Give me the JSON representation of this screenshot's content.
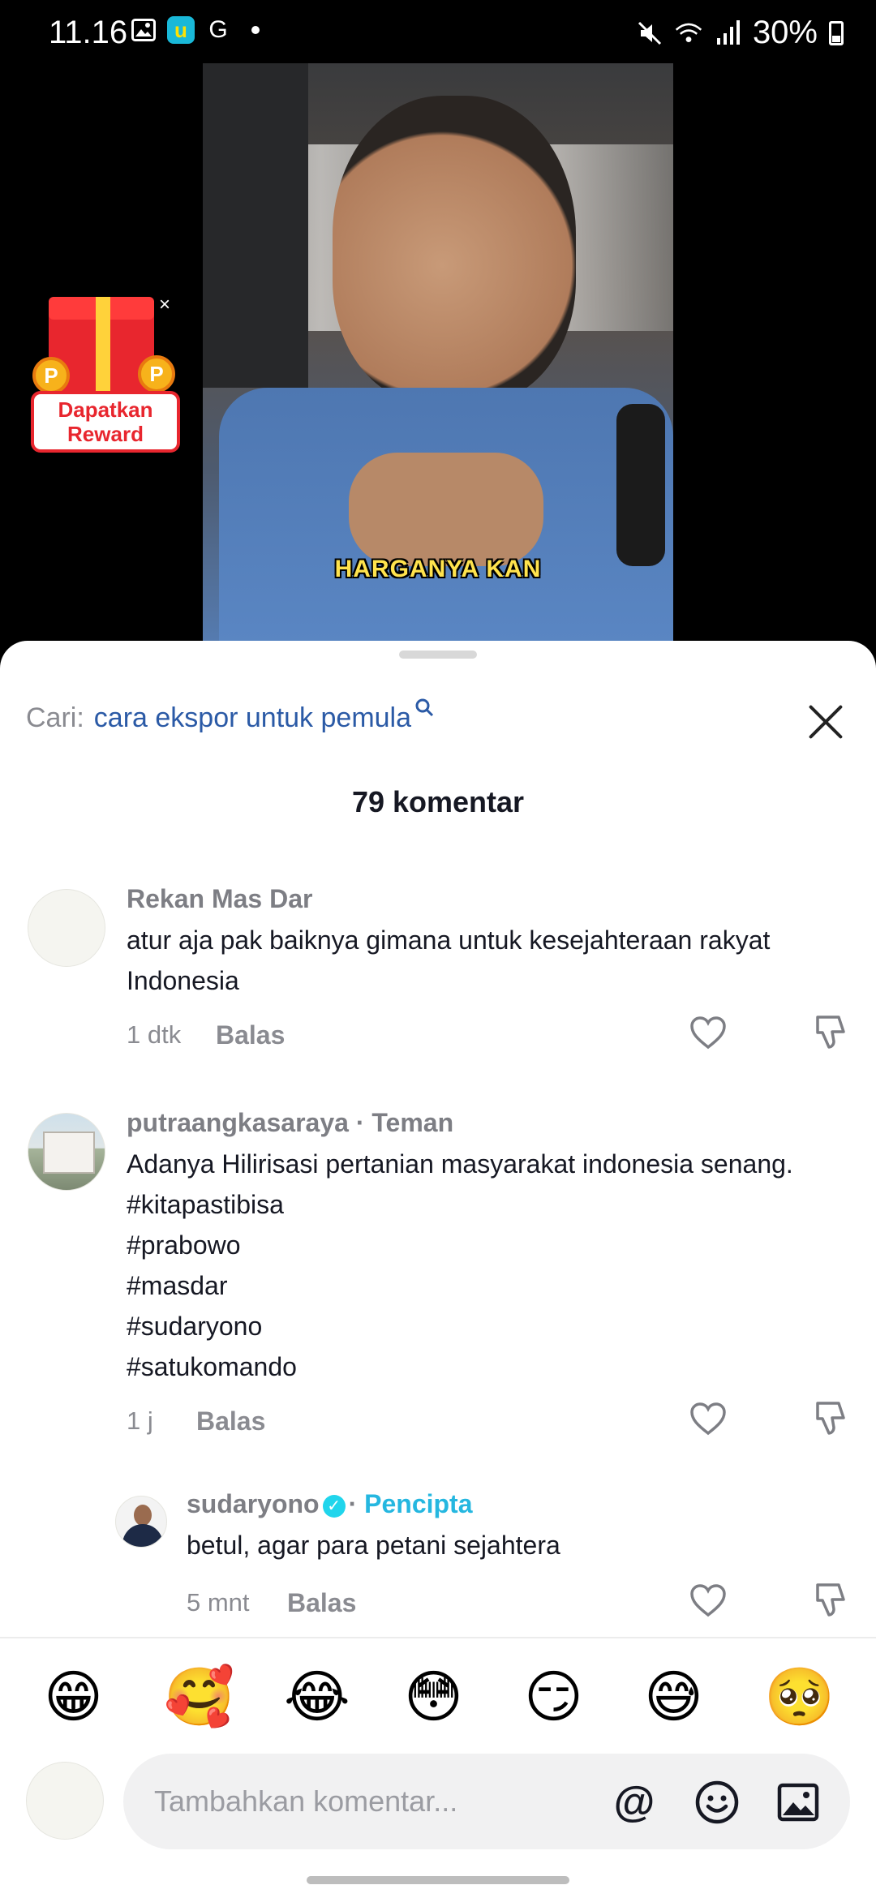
{
  "status_bar": {
    "time": "11.16",
    "battery": "30%"
  },
  "video": {
    "caption": "HARGANYA KAN"
  },
  "reward": {
    "line1": "Dapatkan",
    "line2": "Reward",
    "close": "×"
  },
  "search": {
    "prefix": "Cari:",
    "query": "cara ekspor untuk pemula"
  },
  "comments_header": {
    "count_label": "79 komentar"
  },
  "comments": [
    {
      "username": "Rekan Mas Dar",
      "text": "atur aja pak baiknya gimana untuk kesejahteraan rakyat Indonesia",
      "time": "1 dtk",
      "reply": "Balas"
    },
    {
      "username": "putraangkasaraya",
      "tag": " · Teman",
      "lines": [
        "Adanya Hilirisasi pertanian masyarakat indonesia senang.",
        "#kitapastibisa",
        "#prabowo",
        "#masdar",
        "#sudaryono",
        "#satukomando"
      ],
      "time": "1 j",
      "reply": "Balas"
    },
    {
      "username": "sudaryono",
      "tag": "Pencipta",
      "text": "betul, agar para petani sejahtera",
      "time": "5 mnt",
      "reply": "Balas"
    }
  ],
  "emojis": [
    "😁",
    "🥰",
    "😂",
    "😳",
    "😏",
    "😅",
    "🥺"
  ],
  "composer": {
    "placeholder": "Tambahkan komentar..."
  },
  "colors": {
    "search_query": "#2b5aa6",
    "creator": "#25b7e0",
    "verified": "#20d5ec"
  }
}
